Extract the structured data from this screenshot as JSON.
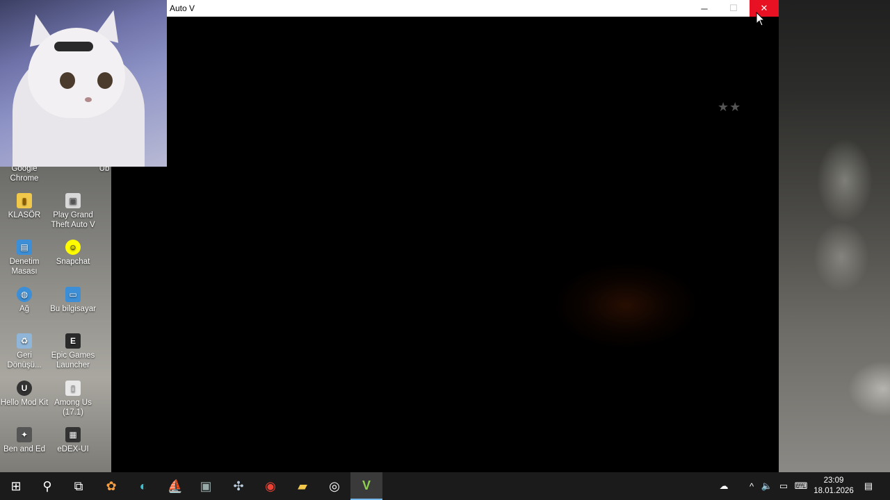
{
  "window": {
    "title": "Auto V",
    "minimize": "─",
    "maximize": "☐",
    "close": "✕",
    "stars": "★★"
  },
  "desktop": {
    "icons": [
      {
        "label": "Google Chrome",
        "icon": "chrome-icon",
        "glyph": "◉",
        "color": "#4285f4"
      },
      {
        "label": "Ub",
        "icon": "partial-icon",
        "glyph": "",
        "color": "#777777"
      },
      {
        "label": "KLASÖR",
        "icon": "folder-icon",
        "glyph": "▮",
        "color": "#f2c84b"
      },
      {
        "label": "Play Grand Theft Auto V",
        "icon": "shortcut-icon",
        "glyph": "▣",
        "color": "#d8d8d8"
      },
      {
        "label": "Denetim Masası",
        "icon": "control-panel-icon",
        "glyph": "▤",
        "color": "#3c8fd6"
      },
      {
        "label": "Snapchat",
        "icon": "snapchat-icon",
        "glyph": "☺",
        "color": "#fffc00"
      },
      {
        "label": "Ağ",
        "icon": "network-icon",
        "glyph": "◍",
        "color": "#3c8fd6"
      },
      {
        "label": "Bu bilgisayar",
        "icon": "computer-icon",
        "glyph": "▭",
        "color": "#3c8fd6"
      },
      {
        "label": "Geri Dönüşü...",
        "icon": "recycle-bin-icon",
        "glyph": "♻",
        "color": "#8fb6d8"
      },
      {
        "label": "Epic Games Launcher",
        "icon": "epic-games-icon",
        "glyph": "E",
        "color": "#2a2a2a"
      },
      {
        "label": "Hello Mod Kit",
        "icon": "unreal-icon",
        "glyph": "U",
        "color": "#333333"
      },
      {
        "label": "Among Us (17.1)",
        "icon": "file-icon",
        "glyph": "▯",
        "color": "#e8e8e8"
      },
      {
        "label": "Ben and Ed",
        "icon": "game-icon",
        "glyph": "✦",
        "color": "#555555"
      },
      {
        "label": "eDEX-UI",
        "icon": "edex-icon",
        "glyph": "▦",
        "color": "#333333"
      }
    ]
  },
  "taskbar": {
    "items": [
      {
        "name": "start-button",
        "glyph": "⊞"
      },
      {
        "name": "search-icon",
        "glyph": "⚲"
      },
      {
        "name": "task-view-icon",
        "glyph": "⧉"
      },
      {
        "name": "copilot-icon",
        "glyph": "✿"
      },
      {
        "name": "edge-icon",
        "glyph": "◐"
      },
      {
        "name": "xbox-app-icon",
        "glyph": "⛵"
      },
      {
        "name": "screenshot-app-icon",
        "glyph": "▣"
      },
      {
        "name": "gamepad-icon",
        "glyph": "✣"
      },
      {
        "name": "chrome-icon",
        "glyph": "◉"
      },
      {
        "name": "file-explorer-icon",
        "glyph": "▰"
      },
      {
        "name": "obs-icon",
        "glyph": "◎"
      },
      {
        "name": "gta-v-icon",
        "glyph": "V"
      }
    ],
    "clock": {
      "time": "23:09",
      "date": "18.01.2026"
    },
    "tray": {
      "weather": "☁",
      "chevron": "^",
      "volume": "🔈",
      "battery": "▭",
      "keyboard": "⌨",
      "notifications": "▤"
    }
  },
  "colors": {
    "close_red": "#e81123",
    "taskbar": "#1b1b1b",
    "accent": "#76b9ed"
  }
}
